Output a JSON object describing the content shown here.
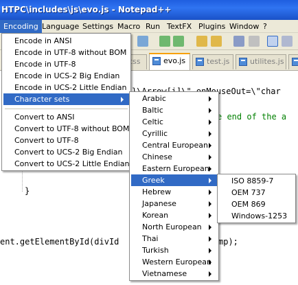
{
  "window": {
    "title": "HTPC\\includes\\js\\evo.js - Notepad++"
  },
  "menubar": {
    "items": [
      "Encoding",
      "Language",
      "Settings",
      "Macro",
      "Run",
      "TextFX",
      "Plugins",
      "Window",
      "?"
    ]
  },
  "tabs": [
    {
      "label": "css"
    },
    {
      "label": "evo.js"
    },
    {
      "label": "test.js"
    },
    {
      "label": "utilites.js"
    },
    {
      "label": "gl"
    }
  ],
  "editor": {
    "line1": "}\\Arrow[i]\\\" onMouseOut=\\\"char",
    "line2": "e end of the a",
    "line3": "}",
    "line4": "ent.getElementById(divId",
    "line5": "mp);"
  },
  "encoding_menu": {
    "items": [
      "Encode in ANSI",
      "Encode in UTF-8 without BOM",
      "Encode in UTF-8",
      "Encode in UCS-2 Big Endian",
      "Encode in UCS-2 Little Endian",
      "Character sets",
      "Convert to ANSI",
      "Convert to UTF-8 without BOM",
      "Convert to UTF-8",
      "Convert to UCS-2 Big Endian",
      "Convert to UCS-2 Little Endian"
    ]
  },
  "charsets_menu": {
    "items": [
      "Arabic",
      "Baltic",
      "Celtic",
      "Cyrillic",
      "Central European",
      "Chinese",
      "Eastern European",
      "Greek",
      "Hebrew",
      "Japanese",
      "Korean",
      "North European",
      "Thai",
      "Turkish",
      "Western European",
      "Vietnamese"
    ]
  },
  "greek_menu": {
    "items": [
      "ISO 8859-7",
      "OEM 737",
      "OEM 869",
      "Windows-1253"
    ]
  },
  "colors": {
    "highlight": "#316ac5",
    "titlebar": "#2f74f1",
    "comment": "#008000"
  }
}
